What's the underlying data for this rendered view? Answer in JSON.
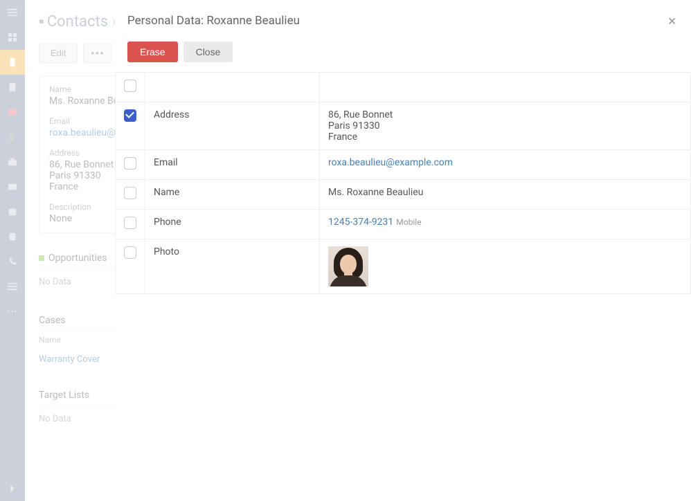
{
  "sidebar": {
    "items": [
      {
        "name": "menu"
      },
      {
        "name": "dashboard"
      },
      {
        "name": "accounts"
      },
      {
        "name": "contacts"
      },
      {
        "name": "leads"
      },
      {
        "name": "opportunities"
      },
      {
        "name": "cases"
      },
      {
        "name": "email"
      },
      {
        "name": "calendar"
      },
      {
        "name": "tasks"
      },
      {
        "name": "calls"
      },
      {
        "name": "list"
      },
      {
        "name": "more"
      }
    ]
  },
  "breadcrumb": {
    "root": "Contacts"
  },
  "edit": {
    "label": "Edit",
    "more": "•••"
  },
  "record": {
    "name_label": "Name",
    "name_value": "Ms. Roxanne Be",
    "email_label": "Email",
    "email_value": "roxa.beaulieu@",
    "address_label": "Address",
    "address_line1": "86, Rue Bonnet",
    "address_line2": "Paris 91330",
    "address_line3": "France",
    "description_label": "Description",
    "description_value": "None"
  },
  "sections": {
    "opportunities": {
      "title": "Opportunities",
      "nodata": "No Data"
    },
    "cases": {
      "title": "Cases",
      "name_col": "Name",
      "row1": "Warranty Cover"
    },
    "targetlists": {
      "title": "Target Lists",
      "nodata": "No Data"
    }
  },
  "modal": {
    "title": "Personal Data: Roxanne Beaulieu",
    "erase": "Erase",
    "close": "Close",
    "close_icon": "×",
    "rows": [
      {
        "checked": true,
        "field": "Address",
        "value_lines": [
          "86, Rue Bonnet",
          "Paris 91330",
          "France"
        ],
        "is_link": false
      },
      {
        "checked": false,
        "field": "Email",
        "value": "roxa.beaulieu@example.com",
        "is_link": true
      },
      {
        "checked": false,
        "field": "Name",
        "value": "Ms. Roxanne Beaulieu",
        "is_link": false
      },
      {
        "checked": false,
        "field": "Phone",
        "value": "1245-374-9231",
        "suffix": "Mobile",
        "is_link": true
      },
      {
        "checked": false,
        "field": "Photo",
        "is_photo": true
      }
    ]
  }
}
